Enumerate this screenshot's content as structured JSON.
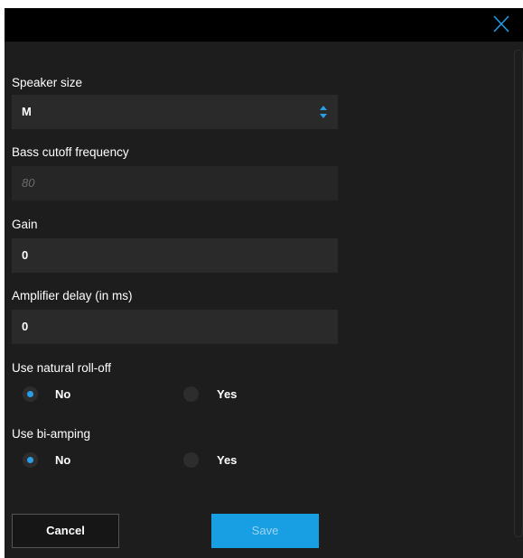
{
  "fields": {
    "speaker_size": {
      "label": "Speaker size",
      "value": "M"
    },
    "bass_cutoff": {
      "label": "Bass cutoff frequency",
      "placeholder": "80"
    },
    "gain": {
      "label": "Gain",
      "value": "0"
    },
    "amp_delay": {
      "label": "Amplifier delay (in ms)",
      "value": "0"
    }
  },
  "natural_rolloff": {
    "label": "Use natural roll-off",
    "options": [
      {
        "label": "No",
        "selected": true
      },
      {
        "label": "Yes",
        "selected": false
      }
    ]
  },
  "bi_amping": {
    "label": "Use bi-amping",
    "options": [
      {
        "label": "No",
        "selected": true
      },
      {
        "label": "Yes",
        "selected": false
      }
    ]
  },
  "buttons": {
    "cancel": "Cancel",
    "save": "Save"
  },
  "colors": {
    "accent": "#179ee3",
    "background": "#1d1d1d",
    "titlebar": "#000000",
    "input": "#2a2a2a"
  },
  "icons": {
    "close": "close-x-icon",
    "select": "up-down-arrows-icon"
  }
}
